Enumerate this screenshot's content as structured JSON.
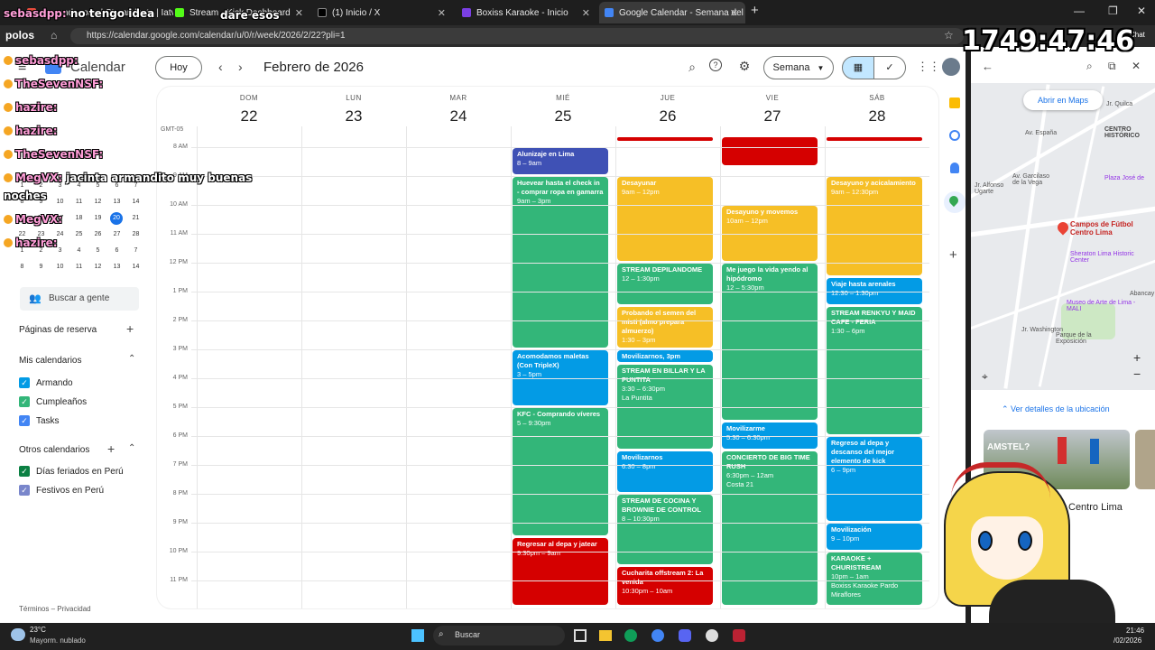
{
  "browser": {
    "tabs": [
      {
        "label": "Armando_ouo | Streamloots | Iatv"
      },
      {
        "label": "Stream - Kick Dashboard"
      },
      {
        "label": "(1) Inicio / X"
      },
      {
        "label": "Boxiss Karaoke - Inicio"
      },
      {
        "label": "Google Calendar - Semana del 22"
      }
    ],
    "url": "https://calendar.google.com/calendar/u/0/r/week/2026/2/22?pli=1",
    "new_tab": "+",
    "profile_label": "polos",
    "chat_label": "Chat"
  },
  "header": {
    "app_name": "Calendar",
    "today_btn": "Hoy",
    "month_title": "Febrero de 2026",
    "view_select": "Semana"
  },
  "week": {
    "timezone": "GMT-05",
    "days": [
      {
        "name": "DOM",
        "num": "22"
      },
      {
        "name": "LUN",
        "num": "23"
      },
      {
        "name": "MAR",
        "num": "24"
      },
      {
        "name": "MIÉ",
        "num": "25"
      },
      {
        "name": "JUE",
        "num": "26"
      },
      {
        "name": "VIE",
        "num": "27"
      },
      {
        "name": "SÁB",
        "num": "28"
      }
    ],
    "hours": [
      "8 AM",
      "9 AM",
      "10 AM",
      "11 AM",
      "12 PM",
      "1 PM",
      "2 PM",
      "3 PM",
      "4 PM",
      "5 PM",
      "6 PM",
      "7 PM",
      "8 PM",
      "9 PM",
      "10 PM",
      "11 PM"
    ]
  },
  "events": {
    "wed": [
      {
        "title": "Alunizaje en Lima",
        "time": "8 – 9am"
      },
      {
        "title": "Huevear hasta el check in - comprar ropa en gamarra",
        "time": "9am – 3pm"
      },
      {
        "title": "Acomodamos maletas (Con TripleX)",
        "time": "3 – 5pm"
      },
      {
        "title": "KFC - Comprando víveres",
        "time": "5 – 9:30pm"
      },
      {
        "title": "Regresar al depa y jatear",
        "time": "9:30pm – 9am"
      }
    ],
    "thu": [
      {
        "title": "Desayunar",
        "time": "9am – 12pm"
      },
      {
        "title": "STREAM DEPILANDOME",
        "time": "12 – 1:30pm"
      },
      {
        "title": "Probando el semen del misti (almo prepara almuerzo)",
        "time": "1:30 – 3pm"
      },
      {
        "title": "Movilizarnos, 3pm",
        "time": ""
      },
      {
        "title": "STREAM EN BILLAR Y LA PUNTITA",
        "time": "3:30 – 6:30pm",
        "loc": "La Puntita"
      },
      {
        "title": "Movilizarnos",
        "time": "6:30 – 8pm"
      },
      {
        "title": "STREAM DE COCINA Y BROWNIE DE CONTROL",
        "time": "8 – 10:30pm"
      },
      {
        "title": "Cucharita offstream 2: La venida",
        "time": "10:30pm – 10am"
      }
    ],
    "fri": [
      {
        "title": "Desayuno y movemos",
        "time": "10am – 12pm"
      },
      {
        "title": "Me juego la vida yendo al hipódromo",
        "time": "12 – 5:30pm"
      },
      {
        "title": "Movilizarme",
        "time": "5:30 – 6:30pm"
      },
      {
        "title": "CONCIERTO DE BIG TIME RUSH",
        "time": "6:30pm – 12am",
        "loc": "Costa 21"
      }
    ],
    "sat": [
      {
        "title": "Desayuno y acicalamiento",
        "time": "9am – 12:30pm"
      },
      {
        "title": "Viaje hasta arenales",
        "time": "12:30 – 1:30pm"
      },
      {
        "title": "STREAM RENKYU Y MAID CAFE - FERIA",
        "time": "1:30 – 6pm"
      },
      {
        "title": "Regreso al depa y descanso del mejor elemento de kick",
        "time": "6 – 9pm"
      },
      {
        "title": "Movilización",
        "time": "9 – 10pm"
      },
      {
        "title": "KARAOKE + CHURISTREAM",
        "time": "10pm – 1am",
        "loc": "Boxiss Karaoke Pardo Miraflores"
      }
    ]
  },
  "sidebar": {
    "search_people": "Buscar a gente",
    "booking_pages": "Páginas de reserva",
    "my_calendars": "Mis calendarios",
    "my_cal_items": [
      "Armando",
      "Cumpleaños",
      "Tasks"
    ],
    "other_calendars": "Otros calendarios",
    "other_cal_items": [
      "Días feriados en Perú",
      "Festivos en Perú"
    ],
    "footer": "Términos – Privacidad",
    "mini_rows": [
      [
        "1",
        "2",
        "3",
        "4",
        "5",
        "6",
        "7"
      ],
      [
        "8",
        "9",
        "10",
        "11",
        "12",
        "13",
        "14"
      ],
      [
        "15",
        "16",
        "17",
        "18",
        "19",
        "20",
        "21"
      ],
      [
        "22",
        "23",
        "24",
        "25",
        "26",
        "27",
        "28"
      ],
      [
        "1",
        "2",
        "3",
        "4",
        "5",
        "6",
        "7"
      ],
      [
        "8",
        "9",
        "10",
        "11",
        "12",
        "13",
        "14"
      ]
    ]
  },
  "maps": {
    "open_btn": "Abrir en Maps",
    "place": "Campos de Fútbol Centro Lima",
    "labels": [
      "CENTRO HISTÓRICO",
      "Plaza José de",
      "Sheraton Lima Historic Center",
      "Museo de Arte de Lima - MALI",
      "Parque de la Exposición",
      "Jr. Alfonso Ugarte",
      "Av. Garcilaso de la Vega",
      "Jr. Washington",
      "Jr. Quilca",
      "Abancay",
      "Av. España"
    ],
    "details": "Ver detalles de la ubicación",
    "photo_caption": "AMSTEL?",
    "place_short": "Centro Lima"
  },
  "stream_overlay": {
    "timer": "1749:47:46",
    "top1": "no tengo idea",
    "top2": "dare esos",
    "top_user": "sebasdpp:",
    "chat": [
      {
        "user": "sebasdpp:",
        "msg": ""
      },
      {
        "user": "TheSevenNSF:",
        "msg": ""
      },
      {
        "user": "hazire:",
        "msg": ""
      },
      {
        "user": "hazire:",
        "msg": ""
      },
      {
        "user": "TheSevenNSF:",
        "msg": ""
      },
      {
        "user": "MegVX:",
        "msg": "jacinta armandito muy buenas"
      },
      {
        "user": "",
        "msg": "noches"
      },
      {
        "user": "MegVX:",
        "msg": ""
      },
      {
        "user": "hazire:",
        "msg": ""
      }
    ]
  },
  "taskbar": {
    "temp": "23°C",
    "weather": "Mayorm. nublado",
    "search": "Buscar",
    "time": "21:46",
    "date": "/02/2026"
  },
  "colors": {
    "blue": "#039be5",
    "green": "#33b679",
    "red": "#d50000",
    "yellow": "#f6bf26",
    "indigo": "#3f51b5"
  }
}
